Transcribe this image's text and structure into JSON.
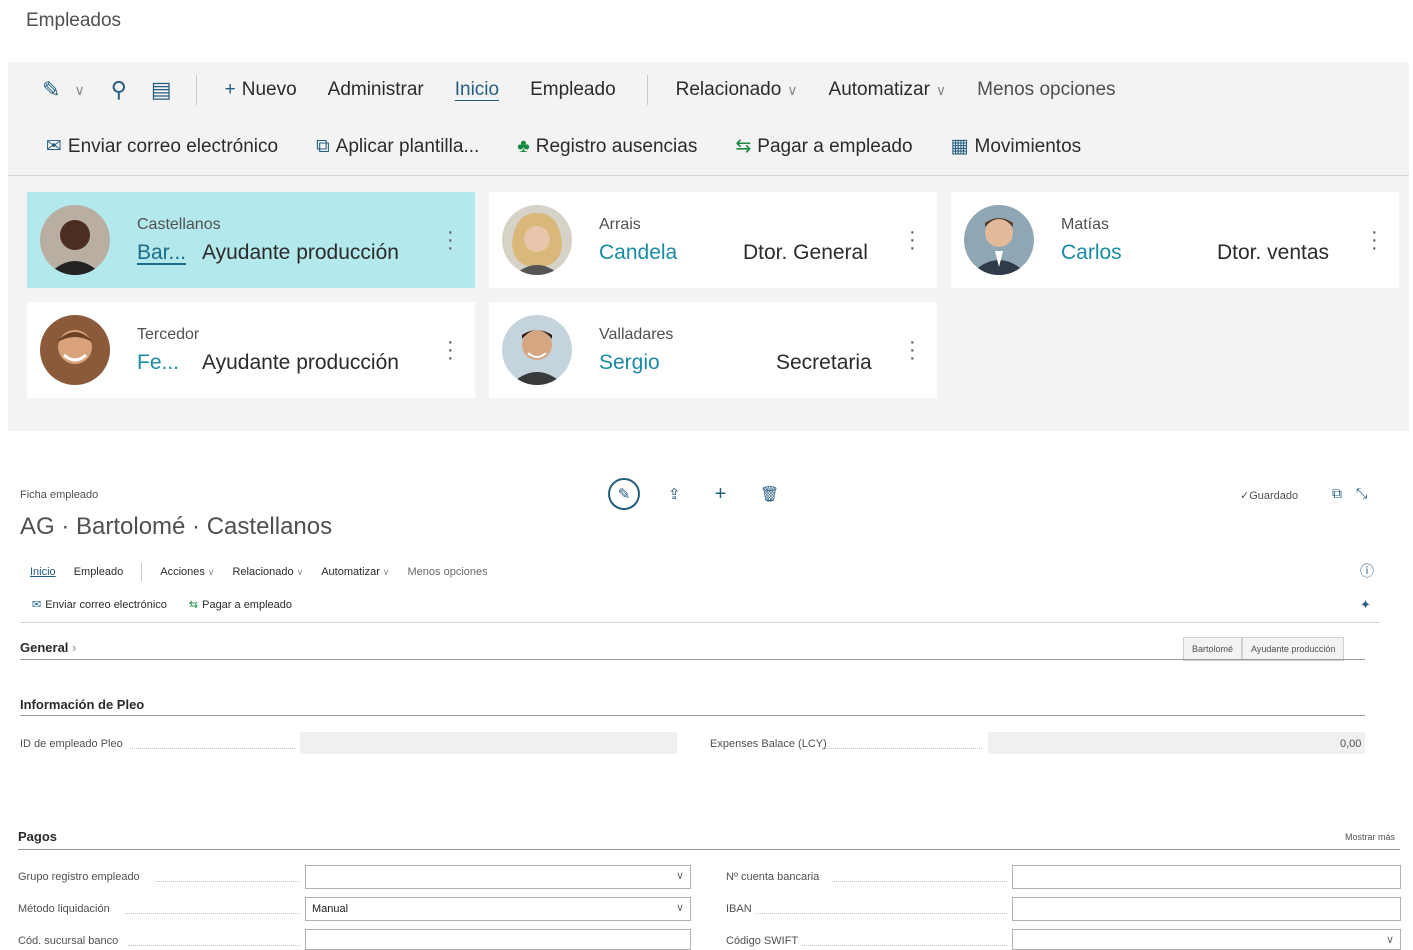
{
  "page": {
    "title": "Empleados"
  },
  "actionbar": {
    "nuevo": "Nuevo",
    "administrar": "Administrar",
    "inicio": "Inicio",
    "empleado": "Empleado",
    "relacionado": "Relacionado",
    "automatizar": "Automatizar",
    "menos": "Menos opciones"
  },
  "subbar": {
    "enviar": "Enviar correo electrónico",
    "aplicar": "Aplicar plantilla...",
    "registro": "Registro ausencias",
    "pagar": "Pagar a empleado",
    "movimientos": "Movimientos"
  },
  "employees": [
    {
      "surname": "Castellanos",
      "firstname": "Bar...",
      "job": "Ayudante producción"
    },
    {
      "surname": "Arrais",
      "firstname": "Candela",
      "job": "Dtor. General"
    },
    {
      "surname": "Matías",
      "firstname": "Carlos",
      "job": "Dtor. ventas"
    },
    {
      "surname": "Tercedor",
      "firstname": "Fe...",
      "job": "Ayudante producción"
    },
    {
      "surname": "Valladares",
      "firstname": "Sergio",
      "job": "Secretaria"
    }
  ],
  "card": {
    "caption": "Ficha empleado",
    "heading": "AG · Bartolomé · Castellanos",
    "saved": "✓Guardado",
    "actions": {
      "inicio": "Inicio",
      "empleado": "Empleado",
      "acciones": "Acciones",
      "relacionado": "Relacionado",
      "automatizar": "Automatizar",
      "menos": "Menos opciones"
    },
    "sub": {
      "enviar": "Enviar correo electrónico",
      "pagar": "Pagar a empleado"
    },
    "general": {
      "title": "General",
      "tag1": "Bartolomé",
      "tag2": "Ayudante producción"
    },
    "pleo": {
      "title": "Información de Pleo",
      "id_label": "ID de empleado Pleo",
      "expenses_label": "Expenses Balace (LCY)",
      "expenses_value": "0,00"
    },
    "pagos": {
      "title": "Pagos",
      "show_more": "Mostrar más",
      "grupo_label": "Grupo registro empleado",
      "grupo_value": "",
      "metodo_label": "Método liquidación",
      "metodo_value": "Manual",
      "sucursal_label": "Cód. sucursal banco",
      "sucursal_value": "",
      "cuenta_label": "Nº cuenta bancaria",
      "cuenta_value": "",
      "iban_label": "IBAN",
      "iban_value": "",
      "swift_label": "Código SWIFT",
      "swift_value": ""
    }
  }
}
